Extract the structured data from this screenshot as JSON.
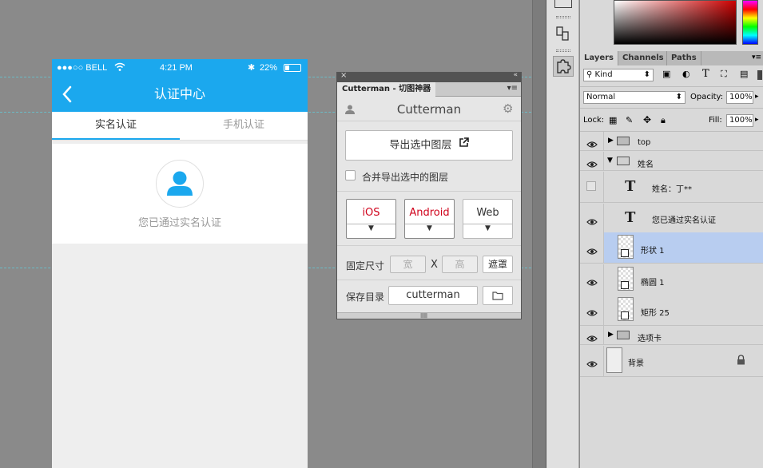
{
  "phone": {
    "status": {
      "carrier": "●●●○○ BELL",
      "time": "4:21 PM",
      "battery": "22%"
    },
    "nav_title": "认证中心",
    "tabs": [
      {
        "label": "实名认证",
        "active": true
      },
      {
        "label": "手机认证",
        "active": false
      }
    ],
    "caption": "您已通过实名认证",
    "accent": "#1ba8ee"
  },
  "cutterman": {
    "tab_label": "Cutterman - 切图神器",
    "header_title": "Cutterman",
    "export_button": "导出选中图层",
    "merge_checkbox": "合并导出选中的图层",
    "platforms": [
      {
        "label": "iOS",
        "color": "#d0021b"
      },
      {
        "label": "Android",
        "color": "#d0021b"
      },
      {
        "label": "Web",
        "color": "#333333"
      }
    ],
    "fixed_size_label": "固定尺寸",
    "width_placeholder": "宽",
    "x_label": "X",
    "height_placeholder": "高",
    "mask_button": "遮罩",
    "save_dir_label": "保存目录",
    "save_dir_value": "cutterman"
  },
  "layers_panel": {
    "tabs": [
      "Layers",
      "Channels",
      "Paths"
    ],
    "filter_kind": "Kind",
    "blend_mode": "Normal",
    "opacity_label": "Opacity:",
    "opacity_value": "100%",
    "lock_label": "Lock:",
    "fill_label": "Fill:",
    "fill_value": "100%",
    "layers": [
      {
        "name": "top",
        "type": "group",
        "visible": true,
        "expanded": false
      },
      {
        "name": "姓名",
        "type": "group",
        "visible": true,
        "expanded": true
      },
      {
        "name": "姓名：丁**",
        "type": "text",
        "visible": false
      },
      {
        "name": "您已通过实名认证",
        "type": "text",
        "visible": true
      },
      {
        "name": "形状 1",
        "type": "shape",
        "visible": true,
        "selected": true
      },
      {
        "name": "椭圆 1",
        "type": "shape",
        "visible": true
      },
      {
        "name": "矩形 25",
        "type": "shape",
        "visible": true
      },
      {
        "name": "选项卡",
        "type": "group",
        "visible": true,
        "expanded": false
      },
      {
        "name": "背景",
        "type": "background",
        "visible": true,
        "locked": true
      }
    ]
  }
}
